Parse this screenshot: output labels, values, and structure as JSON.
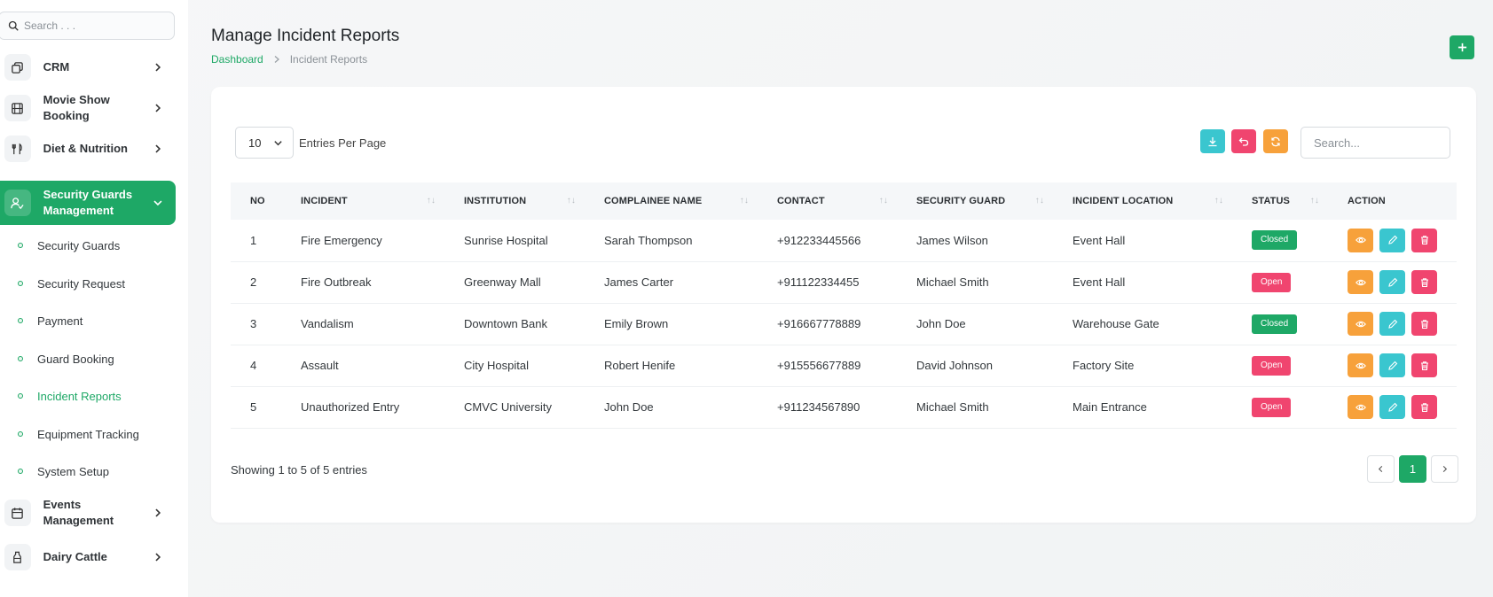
{
  "sidebar": {
    "search_placeholder": "Search . . .",
    "menu": [
      {
        "label": "CRM",
        "icon": "copy-icon"
      },
      {
        "label": "Movie Show Booking",
        "icon": "film-icon"
      },
      {
        "label": "Diet & Nutrition",
        "icon": "utensils-icon"
      },
      {
        "label": "Security Guards Management",
        "icon": "user-check-icon"
      },
      {
        "label": "Events Management",
        "icon": "calendar-icon"
      },
      {
        "label": "Dairy Cattle",
        "icon": "milk-bottle-icon"
      }
    ],
    "submenu": [
      "Security Guards",
      "Security Request",
      "Payment",
      "Guard Booking",
      "Incident Reports",
      "Equipment Tracking",
      "System Setup"
    ]
  },
  "header": {
    "title": "Manage Incident Reports",
    "breadcrumb": {
      "home": "Dashboard",
      "current": "Incident Reports"
    },
    "add_label": "+"
  },
  "controls": {
    "entries_value": "10",
    "entries_label": "Entries Per Page",
    "search_placeholder": "Search..."
  },
  "table": {
    "columns": [
      "NO",
      "INCIDENT",
      "INSTITUTION",
      "COMPLAINEE NAME",
      "CONTACT",
      "SECURITY GUARD",
      "INCIDENT LOCATION",
      "STATUS",
      "ACTION"
    ],
    "sort_glyph": "↑↓",
    "rows": [
      {
        "no": "1",
        "incident": "Fire Emergency",
        "institution": "Sunrise Hospital",
        "complainee": "Sarah Thompson",
        "contact": "+912233445566",
        "guard": "James Wilson",
        "location": "Event Hall",
        "status": "Closed"
      },
      {
        "no": "2",
        "incident": "Fire Outbreak",
        "institution": "Greenway Mall",
        "complainee": "James Carter",
        "contact": "+911122334455",
        "guard": "Michael Smith",
        "location": "Event Hall",
        "status": "Open"
      },
      {
        "no": "3",
        "incident": "Vandalism",
        "institution": "Downtown Bank",
        "complainee": "Emily Brown",
        "contact": "+916667778889",
        "guard": "John Doe",
        "location": "Warehouse Gate",
        "status": "Closed"
      },
      {
        "no": "4",
        "incident": "Assault",
        "institution": "City Hospital",
        "complainee": "Robert Henife",
        "contact": "+915556677889",
        "guard": "David Johnson",
        "location": "Factory Site",
        "status": "Open"
      },
      {
        "no": "5",
        "incident": "Unauthorized Entry",
        "institution": "CMVC University",
        "complainee": "John Doe",
        "contact": "+911234567890",
        "guard": "Michael Smith",
        "location": "Main Entrance",
        "status": "Open"
      }
    ]
  },
  "footer": {
    "showing": "Showing 1 to 5 of 5 entries",
    "current_page": "1"
  },
  "colors": {
    "accent": "#1ea866",
    "danger": "#f0456f",
    "warning": "#f7a13b",
    "info": "#3ac6cf",
    "orange": "#f7a13b"
  }
}
